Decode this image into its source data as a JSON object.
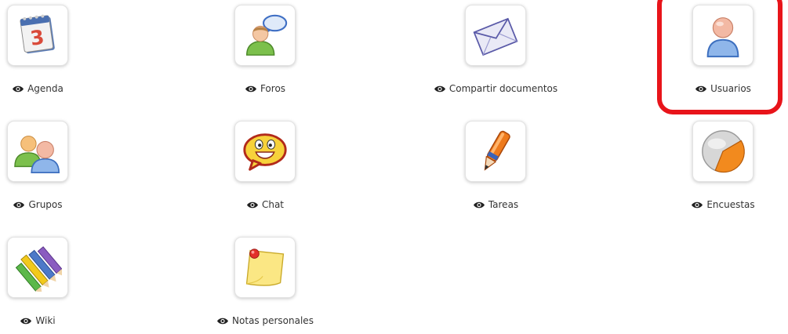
{
  "tools": [
    {
      "label": "Agenda",
      "icon": "calendar-icon"
    },
    {
      "label": "Foros",
      "icon": "forum-user-bubble-icon"
    },
    {
      "label": "Compartir documentos",
      "icon": "envelope-icon"
    },
    {
      "label": "Usuarios",
      "icon": "user-icon"
    },
    {
      "label": "Grupos",
      "icon": "group-users-icon"
    },
    {
      "label": "Chat",
      "icon": "smiley-chat-icon"
    },
    {
      "label": "Tareas",
      "icon": "pen-icon"
    },
    {
      "label": "Encuestas",
      "icon": "pie-survey-icon"
    },
    {
      "label": "Wiki",
      "icon": "pencils-icon"
    },
    {
      "label": "Notas personales",
      "icon": "sticky-note-icon"
    }
  ],
  "calendar": {
    "day": "3"
  },
  "visibility_icon": "eye-icon",
  "colors": {
    "highlight": "#e8141a",
    "caption_text": "#333333"
  }
}
